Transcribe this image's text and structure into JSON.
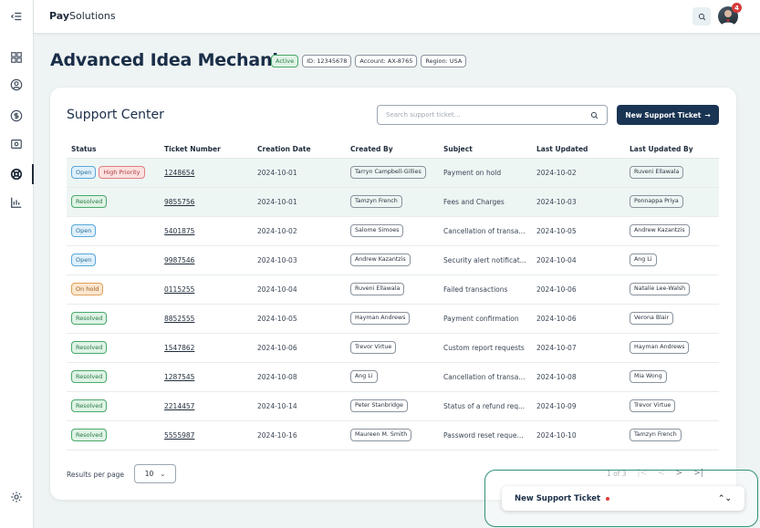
{
  "brand": {
    "bold": "Pay",
    "regular": "Solutions"
  },
  "page": {
    "title": "Advanced Idea Mechanics",
    "chips": [
      {
        "label": "Active",
        "kind": "status"
      },
      {
        "label": "ID: 12345678",
        "kind": "meta"
      },
      {
        "label": "Account: AX-8765",
        "kind": "meta"
      },
      {
        "label": "Region: USA",
        "kind": "meta"
      }
    ]
  },
  "topbar": {
    "notification_count": "4"
  },
  "rail": {
    "items": [
      "menu-collapse-icon",
      "dashboard-icon",
      "user-icon",
      "dollar-icon",
      "ledger-icon",
      "support-icon",
      "chart-icon"
    ],
    "bottom": "settings-icon"
  },
  "support": {
    "title": "Support Center",
    "search_placeholder": "Search support ticket...",
    "new_button": "New Support Ticket",
    "columns": [
      "Status",
      "Ticket Number",
      "Creation Date",
      "Created By",
      "Subject",
      "Last Updated",
      "Last Updated By"
    ],
    "rows": [
      {
        "statuses": [
          "Open",
          "High Priority"
        ],
        "ticket": "1248654",
        "created": "2024-10-01",
        "created_by": "Tarryn Campbell-Gillies",
        "subject": "Payment on hold",
        "updated": "2024-10-02",
        "updated_by": "Ruveni Ellawala"
      },
      {
        "statuses": [
          "Resolved"
        ],
        "ticket": "9855756",
        "created": "2024-10-01",
        "created_by": "Tamzyn French",
        "subject": "Fees and Charges",
        "updated": "2024-10-03",
        "updated_by": "Ponnappa Priya"
      },
      {
        "statuses": [
          "Open"
        ],
        "ticket": "5401875",
        "created": "2024-10-02",
        "created_by": "Salome Simoes",
        "subject": "Cancellation of transa...",
        "updated": "2024-10-05",
        "updated_by": "Andrew Kazantzis"
      },
      {
        "statuses": [
          "Open"
        ],
        "ticket": "9987546",
        "created": "2024-10-03",
        "created_by": "Andrew Kazantzis",
        "subject": "Security alert notificat...",
        "updated": "2024-10-04",
        "updated_by": "Ang Li"
      },
      {
        "statuses": [
          "On hold"
        ],
        "ticket": "0115255",
        "created": "2024-10-04",
        "created_by": "Ruveni Ellawala",
        "subject": "Failed transactions",
        "updated": "2024-10-06",
        "updated_by": "Natalie Lee-Walsh"
      },
      {
        "statuses": [
          "Resolved"
        ],
        "ticket": "8852555",
        "created": "2024-10-05",
        "created_by": "Hayman Andrews",
        "subject": "Payment confirmation",
        "updated": "2024-10-06",
        "updated_by": "Verona Blair"
      },
      {
        "statuses": [
          "Resolved"
        ],
        "ticket": "1547862",
        "created": "2024-10-06",
        "created_by": "Trevor Virtue",
        "subject": "Custom report requests",
        "updated": "2024-10-07",
        "updated_by": "Hayman Andrews"
      },
      {
        "statuses": [
          "Resolved"
        ],
        "ticket": "1287545",
        "created": "2024-10-08",
        "created_by": "Ang Li",
        "subject": "Cancellation of transa...",
        "updated": "2024-10-08",
        "updated_by": "Mia Wong"
      },
      {
        "statuses": [
          "Resolved"
        ],
        "ticket": "2214457",
        "created": "2024-10-14",
        "created_by": "Peter Stanbridge",
        "subject": "Status of a refund req...",
        "updated": "2024-10-09",
        "updated_by": "Trevor Virtue"
      },
      {
        "statuses": [
          "Resolved"
        ],
        "ticket": "5555987",
        "created": "2024-10-16",
        "created_by": "Maureen M. Smith",
        "subject": "Password reset reque...",
        "updated": "2024-10-10",
        "updated_by": "Tamzyn French"
      }
    ],
    "results_per_page_label": "Results per page",
    "results_per_page": "10",
    "pagination": {
      "text": "1 of 3",
      "first": "|<",
      "prev": "<",
      "next": ">",
      "last": ">|"
    }
  },
  "toast": {
    "label": "New Support Ticket"
  },
  "colors": {
    "primary": "#1a3453",
    "accent": "#2f8f7a",
    "alert": "#e03a3a"
  }
}
